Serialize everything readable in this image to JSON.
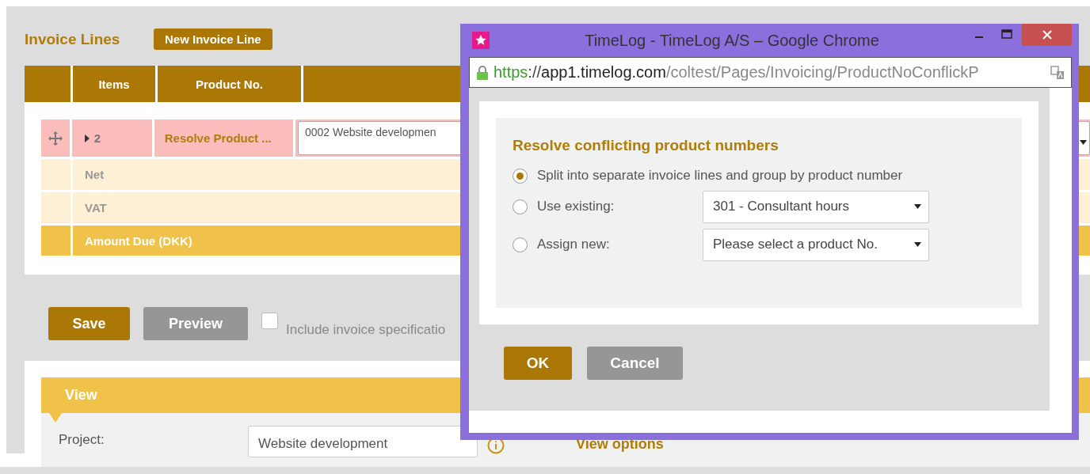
{
  "invoice_lines": {
    "title": "Invoice Lines",
    "new_button": "New Invoice Line",
    "columns": [
      "Items",
      "Product No."
    ],
    "rows": [
      {
        "items": "2",
        "product_no": "Resolve Product ...",
        "description": "0002 Website developmen"
      }
    ],
    "totals": [
      {
        "kind": "subtotal",
        "label": "Net"
      },
      {
        "kind": "subtotal",
        "label": "VAT"
      },
      {
        "kind": "total",
        "label": "Amount Due (DKK)"
      }
    ]
  },
  "actions": {
    "buttons": [
      {
        "label": "Save",
        "kind": "primary"
      },
      {
        "label": "Preview",
        "kind": "secondary"
      }
    ],
    "include_spec": {
      "label": "Include invoice specificatio",
      "checked": false
    }
  },
  "view": {
    "title": "View",
    "project_label": "Project:",
    "project_value": "Website development",
    "options_title": "View options"
  },
  "dialog": {
    "window_title": "TimeLog - TimeLog A/S – Google Chrome",
    "url": {
      "scheme": "https",
      "separator": "://",
      "host": "app1.timelog.com",
      "path": "/coltest/Pages/Invoicing/ProductNoConflickP"
    },
    "heading": "Resolve conflicting product numbers",
    "options": [
      {
        "kind": "plain",
        "label": "Split into separate invoice lines and group by product number",
        "selected": true
      },
      {
        "kind": "select",
        "label": "Use existing:",
        "value": "301 - Consultant hours",
        "selected": false
      },
      {
        "kind": "select",
        "label": "Assign new:",
        "value": "Please select a product No.",
        "selected": false
      }
    ],
    "buttons": [
      {
        "label": "OK",
        "kind": "primary"
      },
      {
        "label": "Cancel",
        "kind": "secondary"
      }
    ]
  }
}
